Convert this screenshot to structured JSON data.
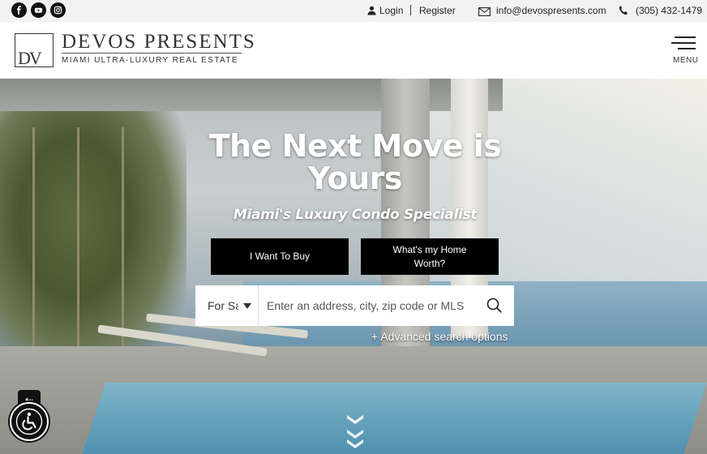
{
  "topbar": {
    "social": [
      {
        "name": "facebook-icon"
      },
      {
        "name": "youtube-icon"
      },
      {
        "name": "instagram-icon"
      }
    ],
    "login_label": "Login",
    "register_label": "Register",
    "email": "info@devospresents.com",
    "phone": "(305) 432-1479"
  },
  "header": {
    "logo_mark": "DV",
    "logo_name": "DEVOS PRESENTS",
    "logo_tagline": "MIAMI ULTRA-LUXURY REAL ESTATE",
    "menu_label": "MENU"
  },
  "hero": {
    "title": "The Next Move is Yours",
    "subtitle": "Miami's Luxury Condo Specialist",
    "buy_button": "I Want To Buy",
    "worth_button": "What's my Home Worth?",
    "search": {
      "type_selected": "For Sale",
      "placeholder": "Enter an address, city, zip code or MLS"
    },
    "advanced_link": "+ Advanced search options"
  },
  "accessibility": {
    "toggle_label": "⇠"
  }
}
